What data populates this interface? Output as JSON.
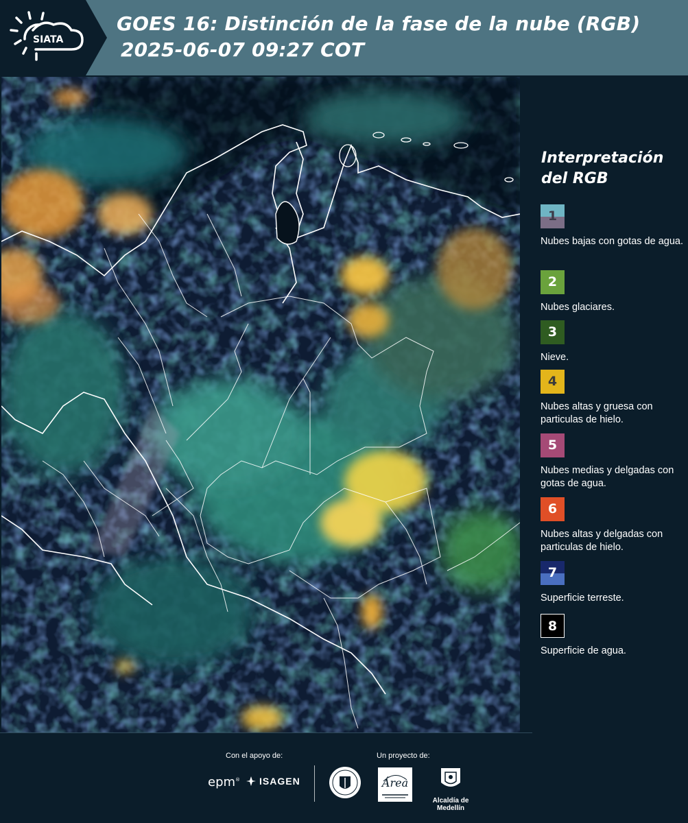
{
  "header": {
    "logo_text": "SIATA",
    "title_line1": "GOES 16: Distinción de la fase de la nube (RGB)",
    "title_line2": "2025-06-07 09:27 COT",
    "background_color": "#4e7482"
  },
  "legend": {
    "title_line1": "Interpretación",
    "title_line2": "del RGB",
    "items": [
      {
        "number": "1",
        "label": "Nubes bajas con gotas de agua.",
        "color_top": "#6fb5c4",
        "color_bottom": "#7b6e86"
      },
      {
        "number": "2",
        "label": "Nubes glaciares.",
        "color": "#6aa23c"
      },
      {
        "number": "3",
        "label": "Nieve.",
        "color": "#2f5c21"
      },
      {
        "number": "4",
        "label": "Nubes altas y gruesa con particulas de hielo.",
        "color": "#e3b51b"
      },
      {
        "number": "5",
        "label": "Nubes medias y delgadas con gotas de agua.",
        "color": "#a54a76"
      },
      {
        "number": "6",
        "label": "Nubes altas y delgadas con particulas de hielo.",
        "color": "#e04f27"
      },
      {
        "number": "7",
        "label": "Superficie terreste.",
        "color_top": "#18286b",
        "color_bottom": "#4a6fc0"
      },
      {
        "number": "8",
        "label": "Superficie de agua.",
        "color": "#000000"
      }
    ]
  },
  "footer": {
    "support_label": "Con el apoyo de:",
    "project_label": "Un proyecto de:",
    "sponsor_1": "epm",
    "sponsor_2": "ISAGEN",
    "partner_3": "Área Metropolitana Valle de Aburrá",
    "partner_4": "Alcaldía de Medellín"
  }
}
